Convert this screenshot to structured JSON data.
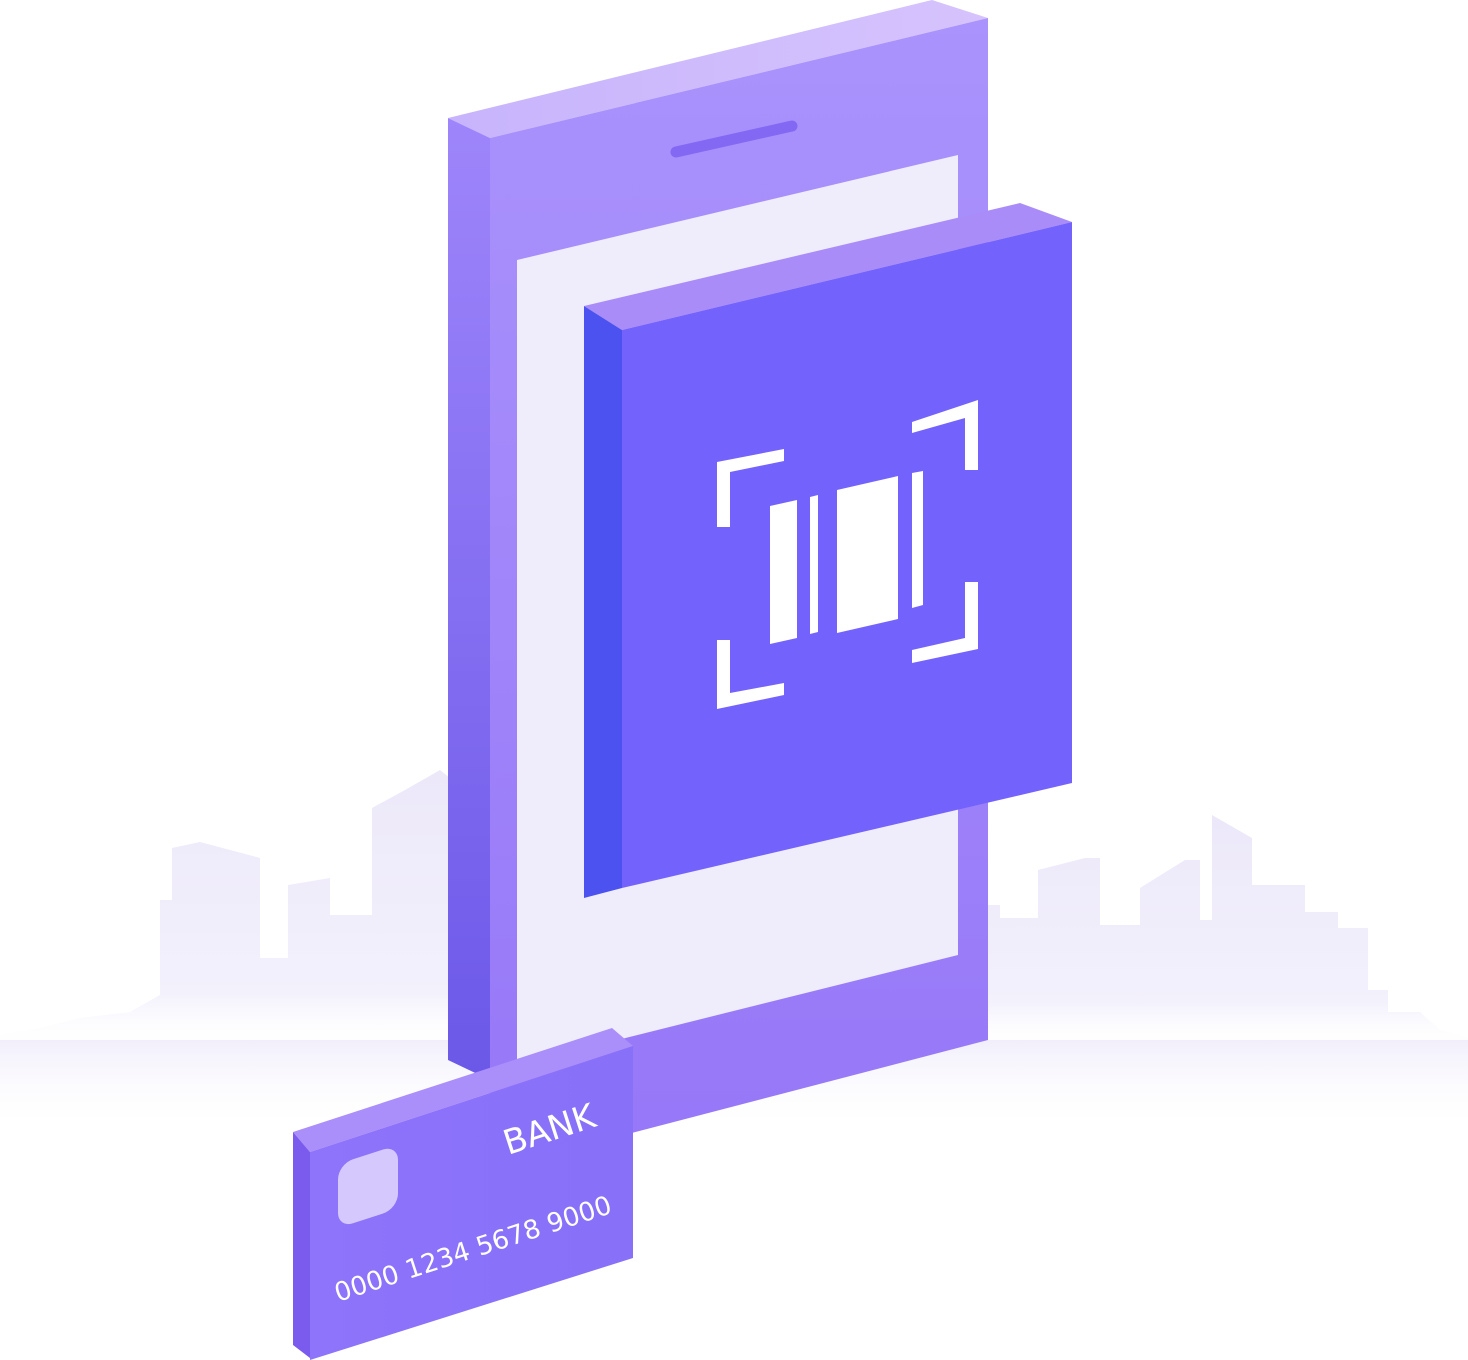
{
  "card": {
    "bank_label": "BANK",
    "number": "0000 1234 5678 9000"
  },
  "icons": {
    "scanner": "barcode-scan-icon",
    "card_chip": "chip-icon",
    "phone_speaker": "speaker-slot-icon"
  },
  "colors": {
    "phone_body": "#A38CFB",
    "phone_side": "#8468F2",
    "phone_top": "#CFBCFD",
    "phone_screen": "#EFEDFB",
    "scanner_face": "#7462FD",
    "scanner_side": "#4C52F0",
    "scanner_top": "#AB8EF9",
    "card_face": "#8F76FB",
    "card_side": "#7B5BEE",
    "card_top": "#AA8EFA",
    "chip": "#D5C8FC",
    "skyline": "#EFEBFB"
  }
}
